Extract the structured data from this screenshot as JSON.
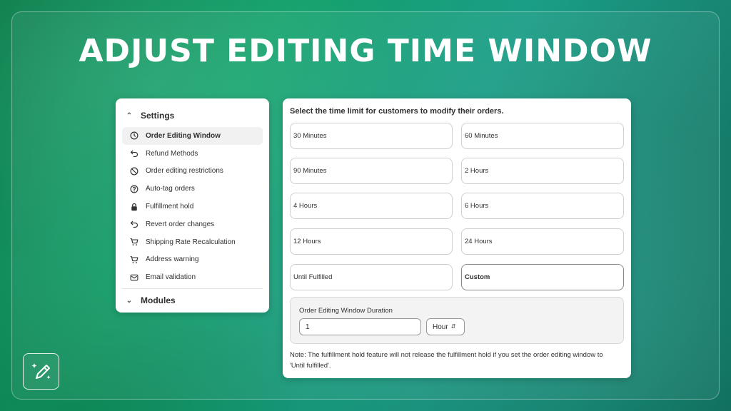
{
  "page_title": "ADJUST EDITING TIME WINDOW",
  "sidebar": {
    "settings_label": "Settings",
    "modules_label": "Modules",
    "items": [
      {
        "label": "Order Editing Window",
        "icon": "clock-icon"
      },
      {
        "label": "Refund Methods",
        "icon": "undo-arrow-icon"
      },
      {
        "label": "Order editing restrictions",
        "icon": "prohibited-icon"
      },
      {
        "label": "Auto-tag orders",
        "icon": "question-circle-icon"
      },
      {
        "label": "Fulfillment hold",
        "icon": "lock-icon"
      },
      {
        "label": "Revert order changes",
        "icon": "undo-arrow-icon"
      },
      {
        "label": "Shipping Rate Recalculation",
        "icon": "cart-icon"
      },
      {
        "label": "Address warning",
        "icon": "cart-icon"
      },
      {
        "label": "Email validation",
        "icon": "envelope-icon"
      }
    ]
  },
  "panel": {
    "heading": "Select the time limit for customers to modify their orders.",
    "options": [
      "30 Minutes",
      "60 Minutes",
      "90 Minutes",
      "2 Hours",
      "4 Hours",
      "6 Hours",
      "12 Hours",
      "24 Hours",
      "Until Fulfilled",
      "Custom"
    ],
    "selected_option": "Custom",
    "duration": {
      "label": "Order Editing Window Duration",
      "value": "1",
      "unit": "Hour"
    },
    "note": "Note: The fulfillment hold feature will not release the fulfillment hold if you set the order editing window to 'Until fulfilled'."
  },
  "badge_icon": "magic-pencil-icon",
  "colors": {
    "background_primary": "#13a06a",
    "background_secondary": "#17806e",
    "title_text": "#ffffff",
    "active_nav_bg": "#f1f1f1"
  }
}
